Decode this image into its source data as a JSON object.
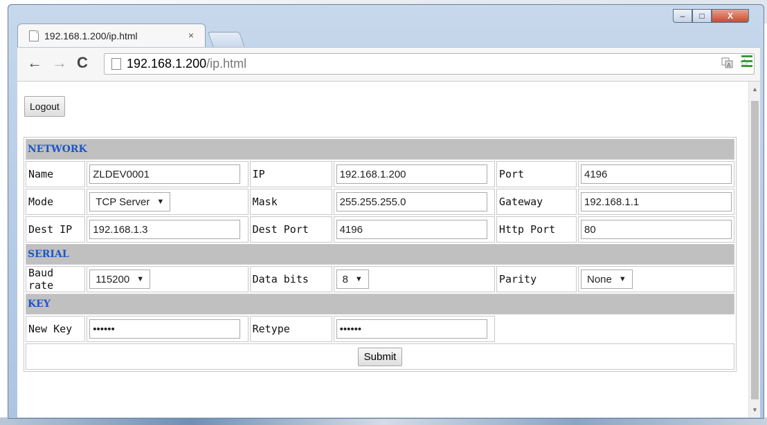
{
  "browser": {
    "tab_title": "192.168.1.200/ip.html",
    "tab_close": "×",
    "url_host": "192.168.1.200",
    "url_path": "/ip.html",
    "back": "←",
    "forward": "→",
    "reload": "C",
    "translate_icon": "translate-icon",
    "star": "☆",
    "window_min": "–",
    "window_max": "□",
    "window_close": "X"
  },
  "page": {
    "logout_label": "Logout",
    "submit_label": "Submit"
  },
  "network": {
    "heading": "NETWORK",
    "name_label": "Name",
    "name_value": "ZLDEV0001",
    "ip_label": "IP",
    "ip_value": "192.168.1.200",
    "port_label": "Port",
    "port_value": "4196",
    "mode_label": "Mode",
    "mode_value": "TCP Server",
    "mask_label": "Mask",
    "mask_value": "255.255.255.0",
    "gateway_label": "Gateway",
    "gateway_value": "192.168.1.1",
    "destip_label": "Dest IP",
    "destip_value": "192.168.1.3",
    "destport_label": "Dest Port",
    "destport_value": "4196",
    "httpport_label": "Http Port",
    "httpport_value": "80"
  },
  "serial": {
    "heading": "SERIAL",
    "baud_label_1": "Baud",
    "baud_label_2": "rate",
    "baud_value": "115200",
    "databits_label": "Data bits",
    "databits_value": "8",
    "parity_label": "Parity",
    "parity_value": "None"
  },
  "key": {
    "heading": "KEY",
    "newkey_label": "New Key",
    "newkey_value": "••••••",
    "retype_label": "Retype",
    "retype_value": "••••••"
  },
  "colors": {
    "section_heading": "#1a56c8",
    "section_bg": "#c0c0c0",
    "menu_green": "#3b9a3b"
  }
}
